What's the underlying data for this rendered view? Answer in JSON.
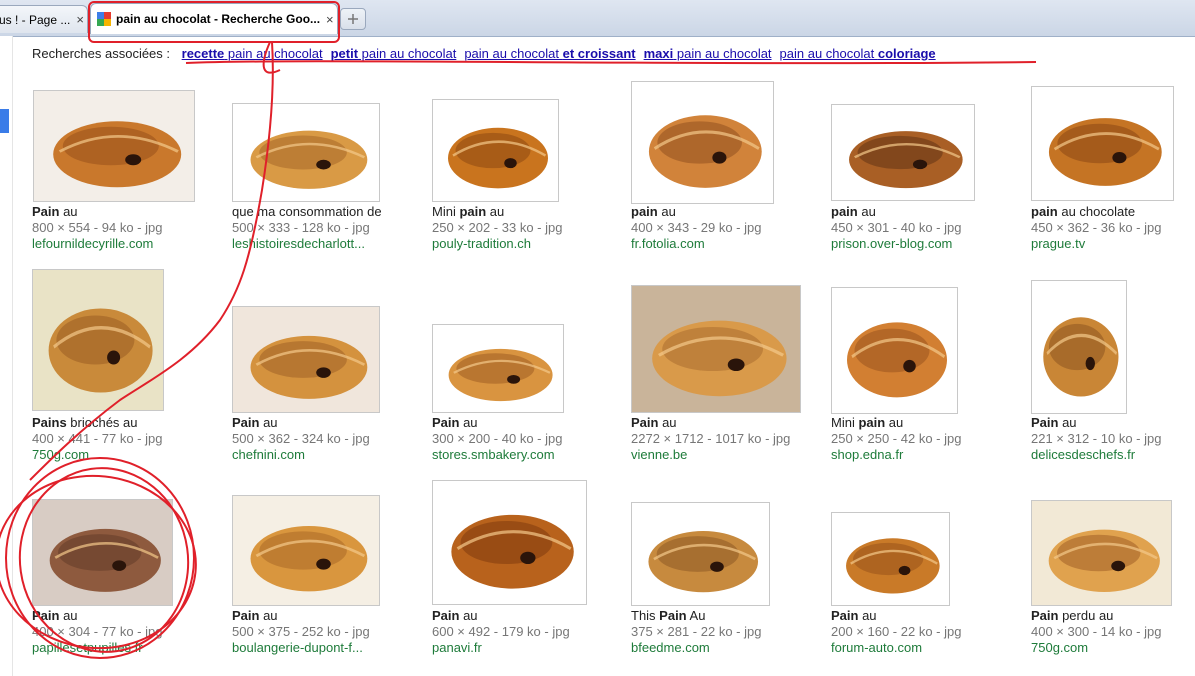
{
  "tabs": [
    {
      "label": "us ! - Page ...",
      "close": "×"
    },
    {
      "label": "pain au chocolat - Recherche Goo...",
      "close": "×"
    }
  ],
  "new_tab_icon": "new-tab-icon",
  "related": {
    "prefix": "Recherches associées :",
    "items": [
      {
        "bold1": "recette",
        "plain": " pain au chocolat",
        "bold2": ""
      },
      {
        "bold1": "petit",
        "plain": " pain au chocolat",
        "bold2": ""
      },
      {
        "bold1": "",
        "plain": "pain au chocolat ",
        "bold2": "et croissant"
      },
      {
        "bold1": "maxi",
        "plain": " pain au chocolat",
        "bold2": ""
      },
      {
        "bold1": "",
        "plain": "pain au chocolat ",
        "bold2": "coloriage"
      }
    ]
  },
  "results": [
    {
      "b1": "Pain",
      "r1": " au",
      "b2": "",
      "r2": "",
      "meta": "800 × 554 - 94 ko - jpg",
      "site": "lefournildecyrille.com"
    },
    {
      "b1": "",
      "r1": "que ma consommation de",
      "b2": "",
      "r2": "",
      "meta": "500 × 333 - 128 ko - jpg",
      "site": "leshistoiresdecharlott..."
    },
    {
      "b1": "",
      "r1": "Mini ",
      "b2": "pain",
      "r2": " au",
      "meta": "250 × 202 - 33 ko - jpg",
      "site": "pouly-tradition.ch"
    },
    {
      "b1": "pain",
      "r1": " au",
      "b2": "",
      "r2": "",
      "meta": "400 × 343 - 29 ko - jpg",
      "site": "fr.fotolia.com"
    },
    {
      "b1": "pain",
      "r1": " au",
      "b2": "",
      "r2": "",
      "meta": "450 × 301 - 40 ko - jpg",
      "site": "prison.over-blog.com"
    },
    {
      "b1": "pain",
      "r1": " au chocolate",
      "b2": "",
      "r2": "",
      "meta": "450 × 362 - 36 ko - jpg",
      "site": "prague.tv"
    },
    {
      "b1": "Pains",
      "r1": " briochés au",
      "b2": "",
      "r2": "",
      "meta": "400 × 441 - 77 ko - jpg",
      "site": "750g.com"
    },
    {
      "b1": "Pain",
      "r1": " au",
      "b2": "",
      "r2": "",
      "meta": "500 × 362 - 324 ko - jpg",
      "site": "chefnini.com"
    },
    {
      "b1": "Pain",
      "r1": " au",
      "b2": "",
      "r2": "",
      "meta": "300 × 200 - 40 ko - jpg",
      "site": "stores.smbakery.com"
    },
    {
      "b1": "Pain",
      "r1": " au",
      "b2": "",
      "r2": "",
      "meta": "2272 × 1712 - 1017 ko - jpg",
      "site": "vienne.be"
    },
    {
      "b1": "",
      "r1": "Mini ",
      "b2": "pain",
      "r2": " au",
      "meta": "250 × 250 - 42 ko - jpg",
      "site": "shop.edna.fr"
    },
    {
      "b1": "Pain",
      "r1": " au",
      "b2": "",
      "r2": "",
      "meta": "221 × 312 - 10 ko - jpg",
      "site": "delicesdeschefs.fr"
    },
    {
      "b1": "Pain",
      "r1": " au",
      "b2": "",
      "r2": "",
      "meta": "400 × 304 - 77 ko - jpg",
      "site": "papillesetpupilles.fr"
    },
    {
      "b1": "Pain",
      "r1": " au",
      "b2": "",
      "r2": "",
      "meta": "500 × 375 - 252 ko - jpg",
      "site": "boulangerie-dupont-f..."
    },
    {
      "b1": "Pain",
      "r1": " au",
      "b2": "",
      "r2": "",
      "meta": "600 × 492 - 179 ko - jpg",
      "site": "panavi.fr"
    },
    {
      "b1": "",
      "r1": "This ",
      "b2": "Pain",
      "r2": " Au",
      "meta": "375 × 281 - 22 ko - jpg",
      "site": "bfeedme.com"
    },
    {
      "b1": "Pain",
      "r1": " au",
      "b2": "",
      "r2": "",
      "meta": "200 × 160 - 22 ko - jpg",
      "site": "forum-auto.com"
    },
    {
      "b1": "Pain",
      "r1": " perdu au",
      "b2": "",
      "r2": "",
      "meta": "400 × 300 - 14 ko - jpg",
      "site": "750g.com"
    }
  ],
  "colors": {
    "annotation": "#e0202a",
    "link": "#1a0dab",
    "site": "#1e7b3a",
    "meta": "#767676"
  }
}
